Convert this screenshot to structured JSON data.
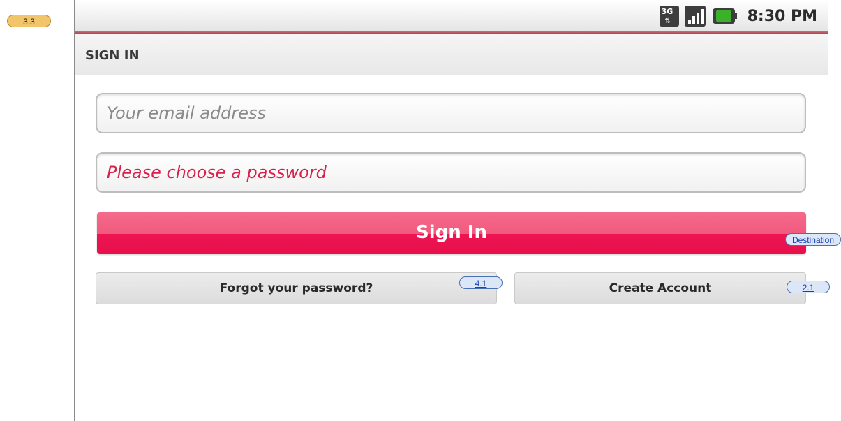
{
  "annotations": {
    "page_id": "3.3",
    "forgot_link": "4.1",
    "create_link": "2.1",
    "signin_link": "Destination"
  },
  "status_bar": {
    "network": "3G",
    "network_arrows": "⇅",
    "time": "8:30 PM",
    "icons": [
      "3g-icon",
      "signal-icon",
      "battery-icon"
    ]
  },
  "header": {
    "title": "SIGN IN"
  },
  "form": {
    "email_placeholder": "Your email address",
    "password_placeholder": "Please choose a password",
    "signin_label": "Sign In",
    "forgot_label": "Forgot your password?",
    "create_label": "Create Account"
  },
  "colors": {
    "accent": "#ee1452",
    "error_text": "#d8204d",
    "battery": "#3bb02a"
  }
}
